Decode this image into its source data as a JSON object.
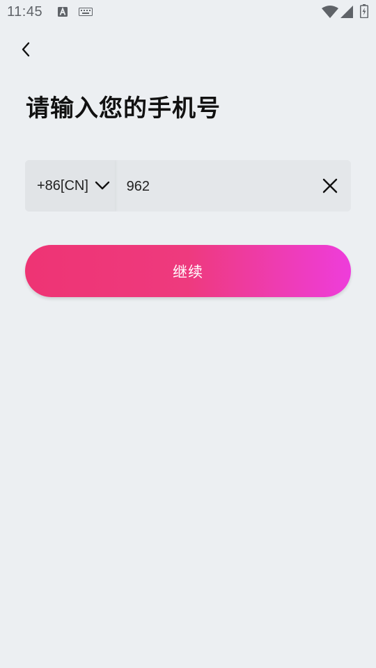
{
  "status_bar": {
    "time": "11:45",
    "icons": [
      "a-icon",
      "keyboard-icon",
      "wifi-icon",
      "signal-icon",
      "battery-icon"
    ]
  },
  "header": {
    "back_icon": "chevron-left-icon",
    "title": "请输入您的手机号"
  },
  "phone_form": {
    "country_code": "+86[CN]",
    "phone_value": "962",
    "clear_icon": "close-icon"
  },
  "continue_button": {
    "label": "继续"
  },
  "colors": {
    "background": "#eceff2",
    "input_background": "#e4e7ea",
    "button_gradient_start": "#ee3474",
    "button_gradient_end": "#ee3ddb"
  }
}
